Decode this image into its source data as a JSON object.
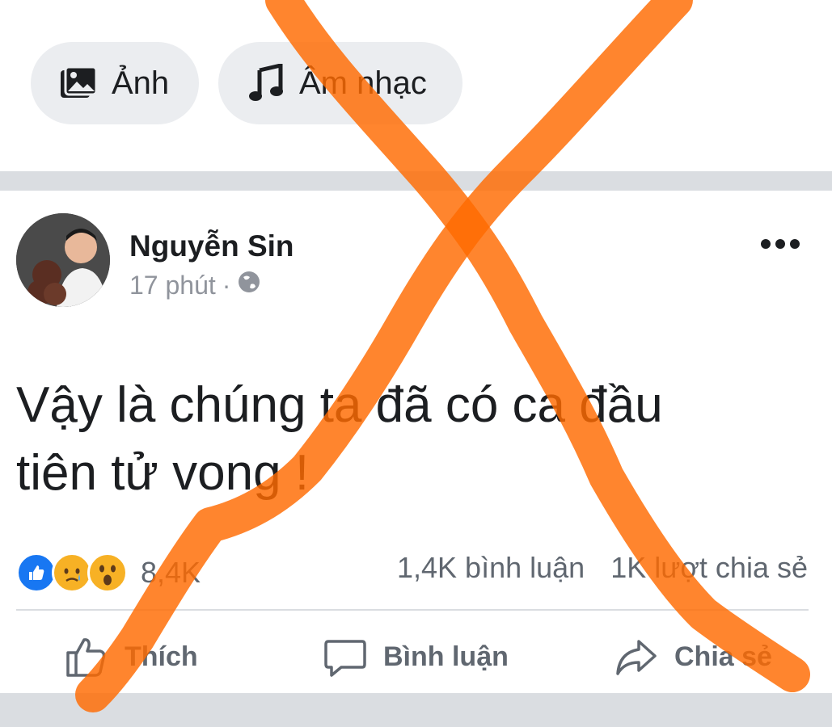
{
  "composer": {
    "photo_label": "Ảnh",
    "music_label": "Âm nhạc"
  },
  "post": {
    "author": "Nguyễn Sin",
    "time": "17 phút",
    "separator": "·",
    "privacy_icon": "globe-icon",
    "text_line1": "Vậy là chúng ta đã có ca đầu",
    "text_line2": "tiên tử vong !",
    "reaction_count": "8,4K",
    "reactions": [
      "like-icon",
      "sad-icon",
      "wow-icon"
    ],
    "comments_count": "1,4K bình luận",
    "shares_count": "1K lượt chia sẻ",
    "actions": {
      "like": "Thích",
      "comment": "Bình luận",
      "share": "Chia sẻ"
    }
  },
  "colors": {
    "chip_bg": "#ebedf0",
    "like_blue": "#1877f2",
    "reaction_yellow": "#f7b125",
    "overlay_orange": "#ff6a00"
  }
}
